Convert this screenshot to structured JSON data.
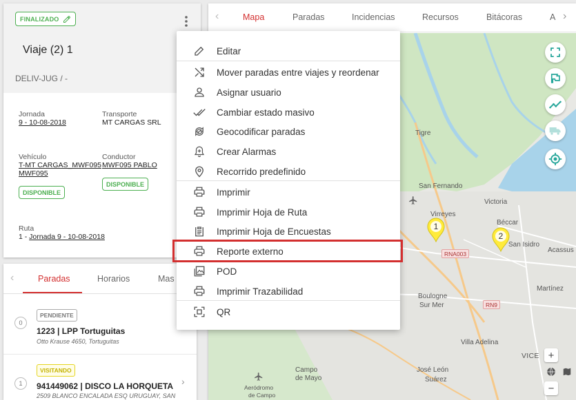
{
  "trip": {
    "status": "FINALIZADO",
    "title": "Viaje (2) 1",
    "code": "DELIV-JUG / -",
    "jornada_label": "Jornada",
    "jornada_value": "9 - 10-08-2018",
    "transporte_label": "Transporte",
    "transporte_value": "MT CARGAS SRL",
    "vehiculo_label": "Vehículo",
    "vehiculo_line1": "T-MT CARGAS_MWF095",
    "vehiculo_line2": "MWF095",
    "vehiculo_status": "DISPONIBLE",
    "conductor_label": "Conductor",
    "conductor_value": "MWF095 PABLO",
    "conductor_status": "DISPONIBLE",
    "ruta_label": "Ruta",
    "ruta_prefix": "1 - ",
    "ruta_link": "Jornada 9 - 10-08-2018"
  },
  "stops_tabs": [
    "Paradas",
    "Horarios",
    "Mas I"
  ],
  "stops": [
    {
      "num": "0",
      "status": "PENDIENTE",
      "name": "1223 | LPP Tortuguitas",
      "address": "Otto Krause 4650, Tortuguitas"
    },
    {
      "num": "1",
      "status": "VISITANDO",
      "name": "941449062 | DISCO LA HORQUETA",
      "address": "2509 BLANCO ENCALADA ESQ URUGUAY, SAN"
    }
  ],
  "map_tabs": [
    "Mapa",
    "Paradas",
    "Incidencias",
    "Recursos",
    "Bitácoras",
    "A"
  ],
  "map_labels": {
    "tigre": "Tigre",
    "san_fernando": "San Fernando",
    "victoria": "Victoria",
    "virreyes": "Virreyes",
    "beccar": "Béccar",
    "san_isidro": "San Isidro",
    "acassuso": "Acassus",
    "boulogne": "Boulogne",
    "sur_mer": "Sur Mer",
    "martinez": "Martínez",
    "villa_adelina": "Villa Adelina",
    "jose_leon": "José León",
    "suarez": "Suárez",
    "campo": "Campo",
    "de_mayo": "de Mayo",
    "aerodromo": "Aeródromo",
    "de_campo": "de Campo",
    "vicente": "VICE",
    "rna003": "RNA003",
    "rn9": "RN9"
  },
  "map_pins": [
    "1",
    "2"
  ],
  "map_controls": {
    "zoom_in": "+",
    "zoom_out": "−"
  },
  "menu": [
    {
      "label": "Editar",
      "icon": "pencil-icon"
    },
    {
      "label": "Mover paradas entre viajes y reordenar",
      "icon": "shuffle-icon"
    },
    {
      "label": "Asignar usuario",
      "icon": "user-icon"
    },
    {
      "label": "Cambiar estado masivo",
      "icon": "double-check-icon"
    },
    {
      "label": "Geocodificar paradas",
      "icon": "sync-icon"
    },
    {
      "label": "Crear Alarmas",
      "icon": "add-alarm-icon"
    },
    {
      "label": "Recorrido predefinido",
      "icon": "location-pin-icon"
    },
    {
      "label": "Imprimir",
      "icon": "printer-icon"
    },
    {
      "label": "Imprimir Hoja de Ruta",
      "icon": "printer-icon"
    },
    {
      "label": "Imprimir Hoja de Encuestas",
      "icon": "clipboard-icon"
    },
    {
      "label": "Reporte externo",
      "icon": "printer-icon"
    },
    {
      "label": "POD",
      "icon": "image-icon"
    },
    {
      "label": "Imprimir Trazabilidad",
      "icon": "printer-icon"
    },
    {
      "label": "QR",
      "icon": "qr-scan-icon"
    }
  ],
  "colors": {
    "accent": "#d32f2f",
    "success": "#4caf50",
    "teal": "#26a69a",
    "pin": "#ffeb3b"
  }
}
